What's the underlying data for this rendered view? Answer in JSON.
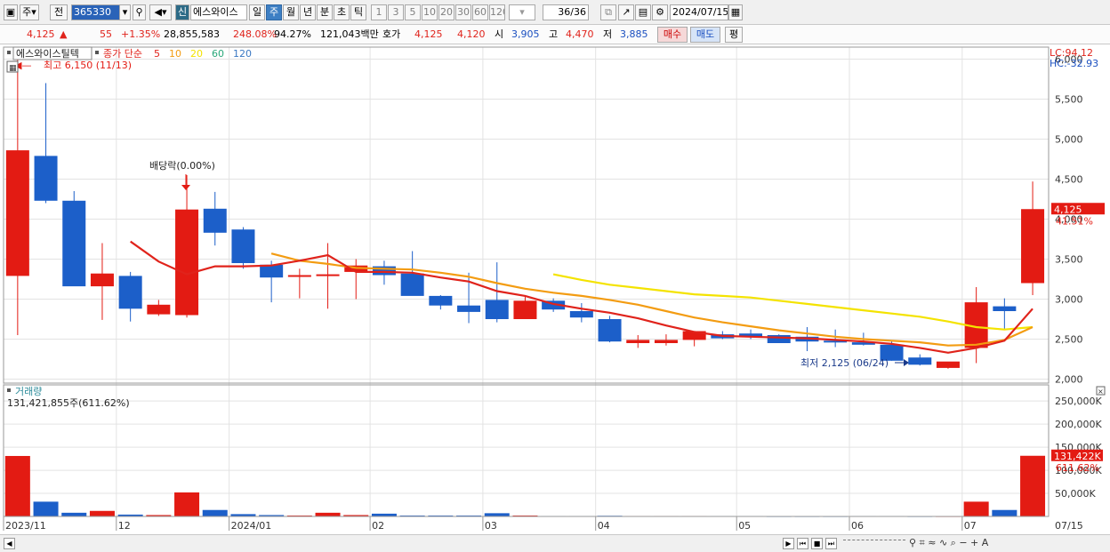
{
  "toolbar": {
    "period_code": "주",
    "prev_label": "전",
    "stock_code": "365330",
    "badge": "신",
    "stock_name": "에스와이스",
    "period_tabs": [
      "일",
      "주",
      "월",
      "년",
      "분",
      "초",
      "틱"
    ],
    "active_period": "주",
    "intervals": [
      "1",
      "3",
      "5",
      "10",
      "20",
      "30",
      "60",
      "120"
    ],
    "count": "36/36",
    "date": "2024/07/15"
  },
  "quote": {
    "price": "4,125",
    "change": "55",
    "change_pct": "+1.35%",
    "volume": "28,855,583",
    "vol_ratio": "248.08%",
    "turnover": "94.27%",
    "amount": "121,043백만",
    "ask_label": "호가",
    "ask": "4,125",
    "bid": "4,120",
    "open_label": "시",
    "open": "3,905",
    "high_label": "고",
    "high": "4,470",
    "low_label": "저",
    "low": "3,885",
    "buy_label": "매수",
    "sell_label": "매도",
    "eval_label": "평"
  },
  "price_panel": {
    "stock_label": "에스와이스틸텍",
    "ma_label": "종가 단순",
    "ma_periods": [
      "5",
      "10",
      "20",
      "60",
      "120"
    ],
    "ma_colors": [
      "#e0231b",
      "#f39c12",
      "#f4e300",
      "#2aa87a",
      "#3a78c2"
    ],
    "lc": "LC:94.12",
    "hc": "HC:-32.93",
    "current_price_tag": "4,125",
    "current_pct_tag": "41.51%",
    "high_note": "최고 6,150 (11/13)",
    "low_note": "최저 2,125 (06/24)",
    "dividend_note": "배당락(0.00%)"
  },
  "volume_panel": {
    "label": "거래량",
    "readout": "131,421,855주(611.62%)",
    "current_tag": "131,422K",
    "current_pct": "611.62%"
  },
  "x_labels": [
    "2023/11",
    "12",
    "2024/01",
    "02",
    "03",
    "04",
    "05",
    "06",
    "07",
    "07/15"
  ],
  "chart_data": {
    "type": "candlestick",
    "categories": [
      "2023-11-06",
      "2023-11-13",
      "2023-11-20",
      "2023-11-27",
      "2023-12-04",
      "2023-12-11",
      "2023-12-18",
      "2023-12-26",
      "2024-01-02",
      "2024-01-08",
      "2024-01-15",
      "2024-01-22",
      "2024-01-29",
      "2024-02-05",
      "2024-02-13",
      "2024-02-19",
      "2024-02-26",
      "2024-03-04",
      "2024-03-11",
      "2024-03-18",
      "2024-03-25",
      "2024-04-01",
      "2024-04-08",
      "2024-04-15",
      "2024-04-22",
      "2024-04-29",
      "2024-05-07",
      "2024-05-13",
      "2024-05-20",
      "2024-05-27",
      "2024-06-03",
      "2024-06-10",
      "2024-06-17",
      "2024-06-24",
      "2024-07-01",
      "2024-07-08",
      "2024-07-15"
    ],
    "open": [
      3290,
      4790,
      4230,
      3160,
      3290,
      2810,
      2800,
      4130,
      3870,
      3430,
      3280,
      3290,
      3340,
      3410,
      3320,
      3040,
      2920,
      2990,
      2750,
      2980,
      2850,
      2750,
      2450,
      2450,
      2490,
      2560,
      2570,
      2550,
      2530,
      2480,
      2460,
      2430,
      2270,
      2140,
      2390,
      2910,
      3200
    ],
    "high": [
      6150,
      5700,
      4350,
      3700,
      3340,
      2990,
      4550,
      4340,
      3900,
      3480,
      3380,
      3700,
      3500,
      3480,
      3600,
      3050,
      3330,
      3460,
      3030,
      3010,
      2950,
      2790,
      2550,
      2560,
      2600,
      2600,
      2620,
      2560,
      2650,
      2620,
      2580,
      2480,
      2310,
      2150,
      3150,
      3010,
      4470
    ],
    "low": [
      2550,
      4200,
      3180,
      2740,
      2720,
      2790,
      2770,
      3670,
      3380,
      2960,
      3010,
      2880,
      3000,
      3180,
      3060,
      2870,
      2700,
      2710,
      2750,
      2840,
      2710,
      2460,
      2390,
      2420,
      2410,
      2500,
      2500,
      2470,
      2350,
      2400,
      2420,
      2230,
      2170,
      2130,
      2200,
      2620,
      3050
    ],
    "close": [
      4860,
      4230,
      3160,
      3320,
      2880,
      2930,
      4120,
      3830,
      3450,
      3270,
      3300,
      3310,
      3420,
      3300,
      3040,
      2920,
      2840,
      2750,
      2980,
      2870,
      2770,
      2470,
      2490,
      2490,
      2600,
      2510,
      2530,
      2450,
      2470,
      2460,
      2430,
      2230,
      2180,
      2220,
      2960,
      2850,
      4125
    ],
    "ma5": [
      null,
      null,
      null,
      null,
      3720,
      3470,
      3310,
      3410,
      3410,
      3420,
      3480,
      3550,
      3340,
      3340,
      3330,
      3270,
      3220,
      3100,
      3040,
      2940,
      2880,
      2830,
      2760,
      2670,
      2590,
      2540,
      2530,
      2520,
      2510,
      2490,
      2470,
      2440,
      2390,
      2330,
      2390,
      2480,
      2880
    ],
    "ma10": [
      null,
      null,
      null,
      null,
      null,
      null,
      null,
      null,
      null,
      3570,
      3480,
      3440,
      3390,
      3380,
      3370,
      3330,
      3280,
      3200,
      3130,
      3080,
      3040,
      2990,
      2930,
      2850,
      2770,
      2710,
      2660,
      2610,
      2570,
      2530,
      2500,
      2480,
      2460,
      2420,
      2430,
      2490,
      2650
    ],
    "ma20": [
      null,
      null,
      null,
      null,
      null,
      null,
      null,
      null,
      null,
      null,
      null,
      null,
      null,
      null,
      null,
      null,
      null,
      null,
      null,
      3310,
      3240,
      3180,
      3140,
      3100,
      3060,
      3040,
      3020,
      2980,
      2940,
      2900,
      2860,
      2820,
      2780,
      2720,
      2650,
      2620,
      2650
    ],
    "volume": [
      131000,
      32000,
      8000,
      12000,
      4000,
      3000,
      52000,
      14000,
      5000,
      3000,
      2000,
      8000,
      3000,
      6000,
      2000,
      2000,
      2000,
      7000,
      2000,
      1000,
      1000,
      1500,
      1000,
      1000,
      1000,
      1000,
      1000,
      800,
      800,
      800,
      1000,
      1000,
      800,
      800,
      32000,
      14000,
      131422
    ],
    "ylim": [
      1950,
      6150
    ],
    "y_ticks": [
      2000,
      2500,
      3000,
      3500,
      4000,
      4500,
      5000,
      5500,
      6000
    ],
    "y_tick_labels": [
      "2,000",
      "2,500",
      "3,000",
      "3,500",
      "4,000",
      "4,500",
      "5,000",
      "5,500",
      "6,000"
    ],
    "volume_ylim": [
      0,
      285000
    ],
    "volume_ticks": [
      50000,
      100000,
      150000,
      200000,
      250000
    ],
    "volume_tick_labels": [
      "50,000K",
      "100,000K",
      "150,000K",
      "200,000K",
      "250,000K"
    ],
    "up_color": "#e31b13",
    "down_color": "#1c5fc9"
  }
}
